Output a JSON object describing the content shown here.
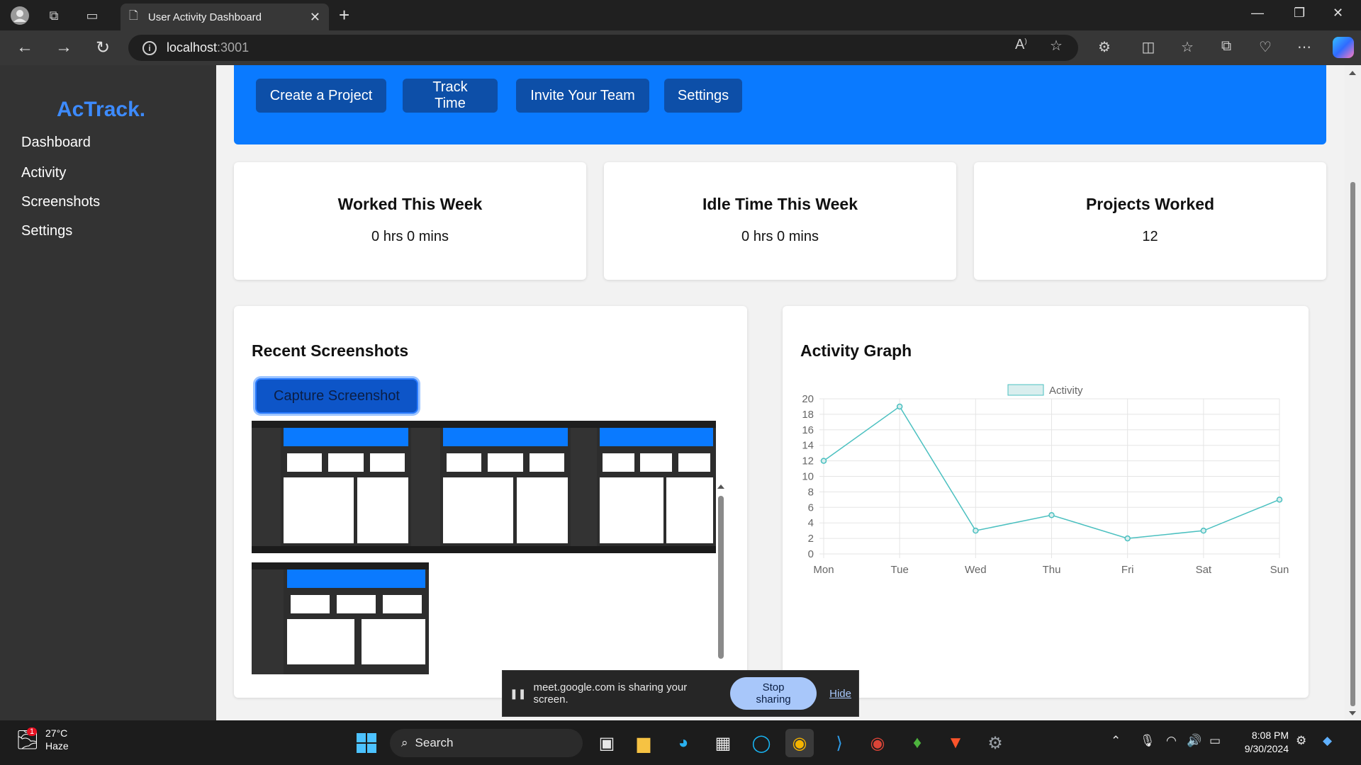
{
  "browser": {
    "tab_title": "User Activity Dashboard",
    "url_host": "localhost",
    "url_port": ":3001"
  },
  "sidebar": {
    "logo": "AcTrack.",
    "items": [
      {
        "label": "Dashboard"
      },
      {
        "label": "Activity"
      },
      {
        "label": "Screenshots"
      },
      {
        "label": "Settings"
      }
    ]
  },
  "hero": {
    "buttons": [
      {
        "label": "Create a Project"
      },
      {
        "label": "Track Time"
      },
      {
        "label": "Invite Your Team"
      },
      {
        "label": "Settings"
      }
    ]
  },
  "stats": [
    {
      "title": "Worked This Week",
      "value": "0 hrs 0 mins"
    },
    {
      "title": "Idle Time This Week",
      "value": "0 hrs 0 mins"
    },
    {
      "title": "Projects Worked",
      "value": "12"
    }
  ],
  "screenshots": {
    "title": "Recent Screenshots",
    "capture_label": "Capture Screenshot",
    "thumb_count": 4
  },
  "graph": {
    "title": "Activity Graph"
  },
  "chart_data": {
    "type": "line",
    "categories": [
      "Mon",
      "Tue",
      "Wed",
      "Thu",
      "Fri",
      "Sat",
      "Sun"
    ],
    "series": [
      {
        "name": "Activity",
        "values": [
          12,
          19,
          3,
          5,
          2,
          3,
          7
        ]
      }
    ],
    "ylim": [
      0,
      20
    ],
    "yticks": [
      0,
      2,
      4,
      6,
      8,
      10,
      12,
      14,
      16,
      18,
      20
    ],
    "grid": true,
    "legend": "top",
    "color": "#4bc0c0",
    "fill": "#d9eeee"
  },
  "share_bar": {
    "text": "meet.google.com is sharing your screen.",
    "stop_label": "Stop sharing",
    "hide_label": "Hide"
  },
  "taskbar": {
    "temperature": "27°C",
    "weather": "Haze",
    "weather_badge": "1",
    "search_label": "Search",
    "time": "8:08 PM",
    "date": "9/30/2024"
  },
  "colors": {
    "brand_blue": "#0a7aff",
    "button_dark_blue": "#0d4fa8",
    "sidebar": "#333333",
    "logo": "#3d8bff"
  }
}
